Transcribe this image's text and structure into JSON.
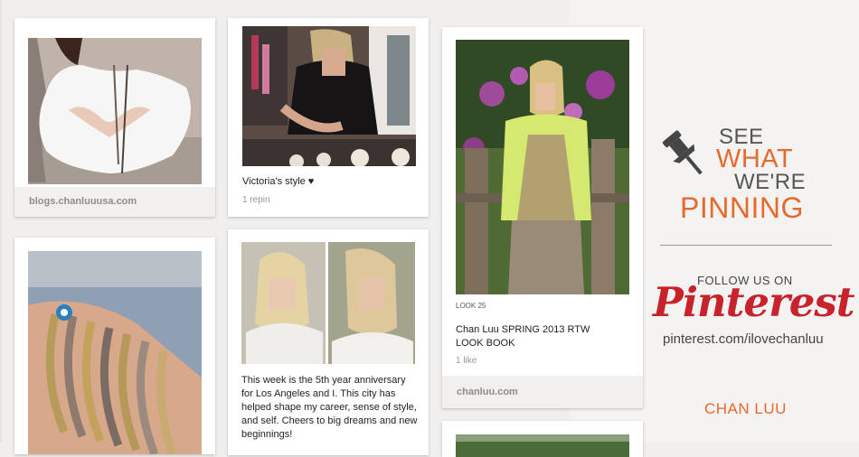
{
  "pins": {
    "pin1": {
      "source": "blogs.chanluuusa.com"
    },
    "pin2": {
      "description": "Victoria's style ♥",
      "repins": "1 repin"
    },
    "pin3": {
      "look": "LOOK 25",
      "description": "Chan Luu SPRING 2013 RTW LOOK BOOK",
      "likes": "1 like",
      "source": "chanluu.com"
    },
    "pin5": {
      "description": "This week is the 5th year anniversary for Los Angeles and I. This city has helped shape my career, sense of style, and self. Cheers to big dreams and new beginnings!"
    }
  },
  "promo": {
    "line1": "SEE",
    "line2": "WHAT",
    "line3": "WE'RE",
    "line4": "PINNING",
    "follow": "FOLLOW US ON",
    "logo": "Pinterest",
    "url": "pinterest.com/ilovechanluu",
    "brand": "CHAN LUU"
  },
  "colors": {
    "accent": "#e46a2e",
    "pinterest_red": "#c8232c"
  }
}
